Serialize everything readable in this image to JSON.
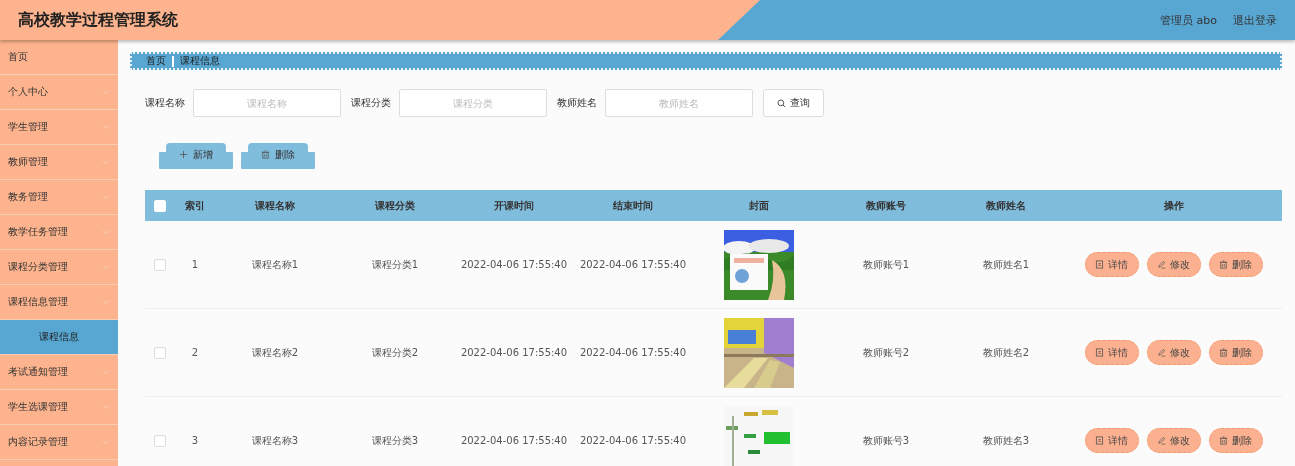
{
  "header": {
    "title": "高校教学过程管理系统",
    "user": "管理员 abo",
    "logout": "退出登录"
  },
  "sidebar": {
    "items": [
      {
        "label": "首页",
        "kind": "link",
        "selected": false
      },
      {
        "label": "个人中心",
        "kind": "menu",
        "selected": false
      },
      {
        "label": "学生管理",
        "kind": "menu",
        "selected": false
      },
      {
        "label": "教师管理",
        "kind": "menu",
        "selected": false
      },
      {
        "label": "教务管理",
        "kind": "menu",
        "selected": false
      },
      {
        "label": "教学任务管理",
        "kind": "menu",
        "selected": false
      },
      {
        "label": "课程分类管理",
        "kind": "menu",
        "selected": false
      },
      {
        "label": "课程信息管理",
        "kind": "menu",
        "selected": false,
        "expanded": true,
        "children": [
          {
            "label": "课程信息",
            "selected": true
          }
        ]
      },
      {
        "label": "考试通知管理",
        "kind": "menu",
        "selected": false
      },
      {
        "label": "学生选课管理",
        "kind": "menu",
        "selected": false
      },
      {
        "label": "内容记录管理",
        "kind": "menu",
        "selected": false
      }
    ]
  },
  "breadcrumb": [
    "首页",
    "课程信息"
  ],
  "search": {
    "fields": [
      {
        "label": "课程名称",
        "placeholder": "课程名称"
      },
      {
        "label": "课程分类",
        "placeholder": "课程分类"
      },
      {
        "label": "教师姓名",
        "placeholder": "教师姓名"
      }
    ],
    "button": "查询"
  },
  "toolbar": [
    {
      "label": "新增",
      "kind": "add"
    },
    {
      "label": "删除",
      "kind": "delete"
    }
  ],
  "table": {
    "select_all": false,
    "columns": [
      "索引",
      "课程名称",
      "课程分类",
      "开课时间",
      "结束时间",
      "封面",
      "教师账号",
      "教师姓名",
      "操作"
    ],
    "rows": [
      {
        "checked": false,
        "index": "1",
        "name": "课程名称1",
        "category": "课程分类1",
        "start": "2022-04-06 17:55:40",
        "end": "2022-04-06 17:55:40",
        "account": "教师账号1",
        "teacher": "教师姓名1",
        "actions": [
          {
            "label": "详情",
            "kind": "detail"
          },
          {
            "label": "修改",
            "kind": "edit"
          },
          {
            "label": "删除",
            "kind": "delete"
          }
        ]
      },
      {
        "checked": false,
        "index": "2",
        "name": "课程名称2",
        "category": "课程分类2",
        "start": "2022-04-06 17:55:40",
        "end": "2022-04-06 17:55:40",
        "account": "教师账号2",
        "teacher": "教师姓名2",
        "actions": [
          {
            "label": "详情",
            "kind": "detail"
          },
          {
            "label": "修改",
            "kind": "edit"
          },
          {
            "label": "删除",
            "kind": "delete"
          }
        ]
      },
      {
        "checked": false,
        "index": "3",
        "name": "课程名称3",
        "category": "课程分类3",
        "start": "2022-04-06 17:55:40",
        "end": "2022-04-06 17:55:40",
        "account": "教师账号3",
        "teacher": "教师姓名3",
        "actions": [
          {
            "label": "详情",
            "kind": "detail"
          },
          {
            "label": "修改",
            "kind": "edit"
          },
          {
            "label": "删除",
            "kind": "delete"
          }
        ]
      }
    ]
  }
}
